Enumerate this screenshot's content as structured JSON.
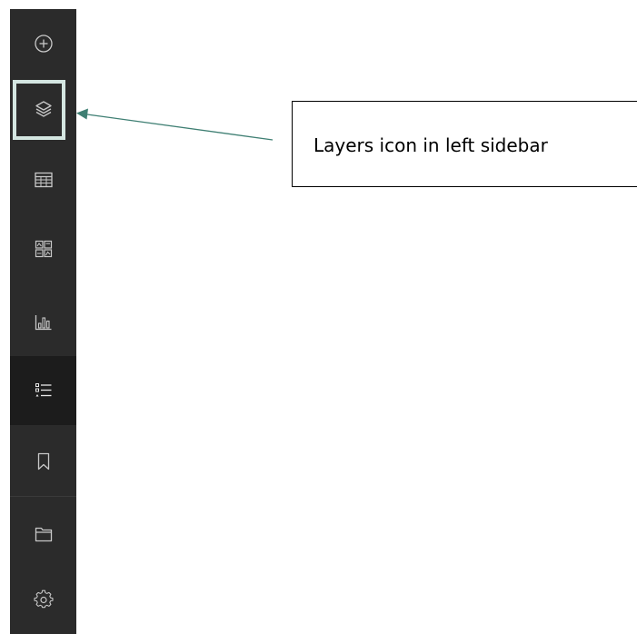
{
  "sidebar": {
    "items": [
      {
        "icon": "add-circle-icon"
      },
      {
        "icon": "layers-icon"
      },
      {
        "icon": "table-icon"
      },
      {
        "icon": "widgets-grid-icon"
      },
      {
        "icon": "bar-chart-icon"
      },
      {
        "icon": "legend-list-icon",
        "active": true
      },
      {
        "icon": "bookmark-icon"
      },
      {
        "icon": "folder-icon"
      },
      {
        "icon": "settings-gear-icon"
      }
    ]
  },
  "annotation": {
    "callout_text": "Layers icon in left sidebar",
    "highlight_color": "#d4e6e1",
    "arrow_color": "#3f7f73"
  },
  "colors": {
    "sidebar_bg": "#2b2b2b",
    "sidebar_active_bg": "#1c1c1c",
    "icon_color": "#c8c8c8"
  }
}
